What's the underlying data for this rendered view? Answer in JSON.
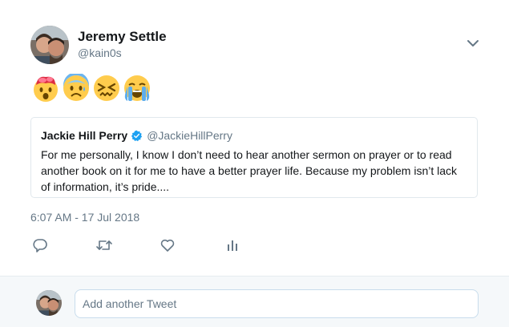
{
  "tweet": {
    "author_name": "Jeremy Settle",
    "author_handle": "@kain0s",
    "emojis": [
      "exploding-head-emoji",
      "anxious-face-emoji",
      "confounded-face-emoji",
      "loudly-crying-face-emoji"
    ],
    "timestamp": "6:07 AM - 17 Jul 2018"
  },
  "quote": {
    "name": "Jackie Hill Perry",
    "handle": "@JackieHillPerry",
    "text": "For me personally, I know I don’t need to hear another sermon on prayer or to read another book on it for me to have a better prayer life. Because my problem isn’t lack of information, it’s pride...."
  },
  "actions": [
    "reply-icon",
    "retweet-icon",
    "like-icon",
    "analytics-icon"
  ],
  "reply": {
    "placeholder": "Add another Tweet"
  },
  "colors": {
    "secondary_text": "#657786",
    "icon": "#657786",
    "verified": "#1da1f2",
    "border": "#e1e8ed",
    "reply_bar_bg": "#f5f8fa"
  }
}
